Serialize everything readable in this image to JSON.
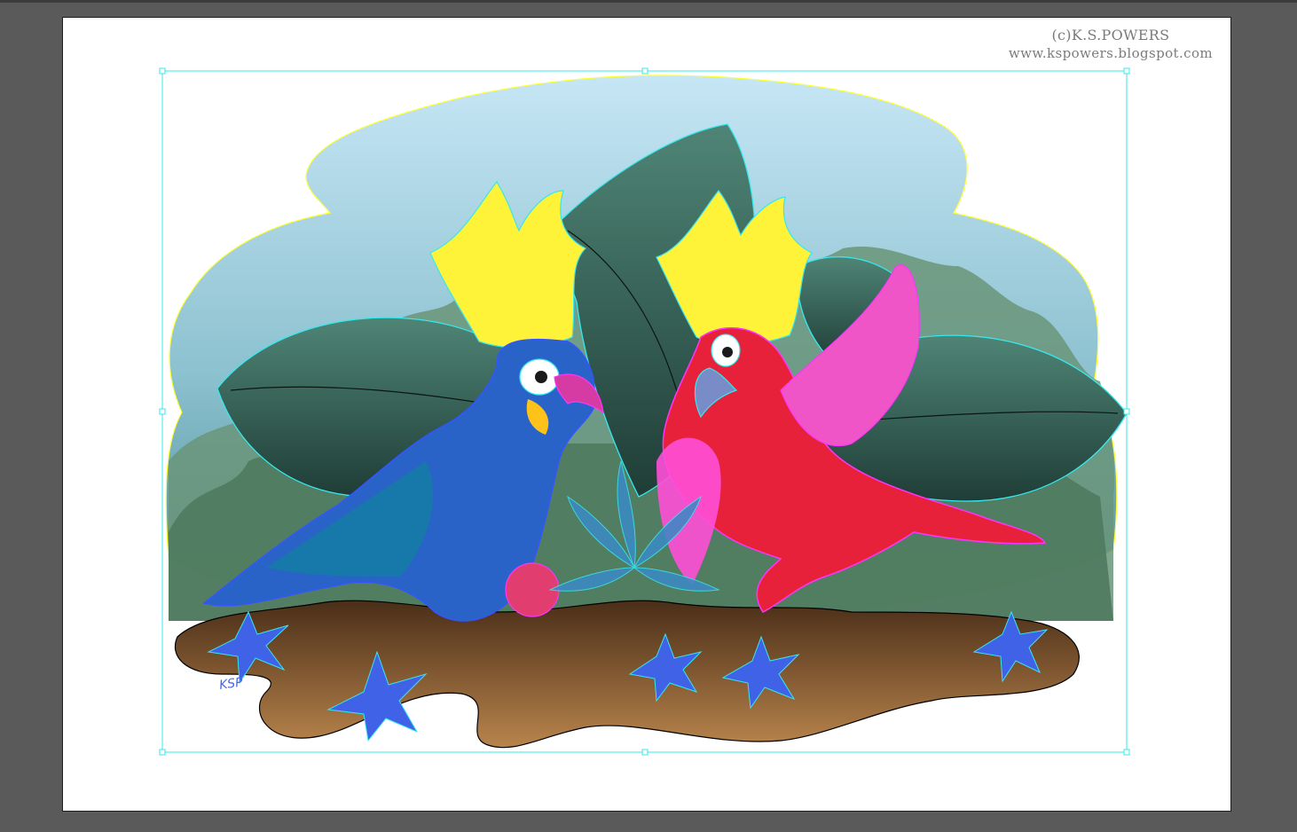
{
  "canvas": {
    "background_color": "#5a5a5a",
    "artboard_color": "#ffffff",
    "selection_color": "#36e8ee"
  },
  "watermark": {
    "line1": "(c)K.S.POWERS",
    "line2": "www.kspowers.blogspot.com"
  },
  "signature": {
    "text": "KSP"
  },
  "artwork": {
    "sky_gradient": [
      "#c6e6f5",
      "#4e8c95"
    ],
    "path_outline_colors": [
      "#ffff33",
      "#36e8ee",
      "#ff33ff",
      "#3355ff",
      "#000000"
    ],
    "parrot_left_color": "#2a63c8",
    "parrot_right_color": "#e8213b",
    "ground_color": "#7a5230"
  },
  "icons": [
    "bounding-box-handle",
    "signature-mark"
  ]
}
